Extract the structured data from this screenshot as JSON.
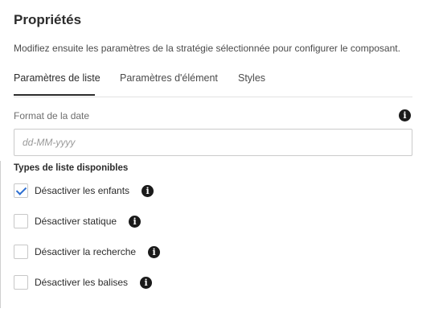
{
  "panel": {
    "title": "Propriétés",
    "description": "Modifiez ensuite les paramètres de la stratégie sélectionnée pour configurer le composant."
  },
  "tabs": [
    {
      "label": "Paramètres de liste",
      "active": true
    },
    {
      "label": "Paramètres d'élément",
      "active": false
    },
    {
      "label": "Styles",
      "active": false
    }
  ],
  "date_format": {
    "label": "Format de la date",
    "placeholder": "dd-MM-yyyy",
    "value": "",
    "info_icon": "info-icon"
  },
  "list_types": {
    "heading": "Types de liste disponibles",
    "items": [
      {
        "label": "Désactiver les enfants",
        "checked": true
      },
      {
        "label": "Désactiver statique",
        "checked": false
      },
      {
        "label": "Désactiver la recherche",
        "checked": false
      },
      {
        "label": "Désactiver les balises",
        "checked": false
      }
    ]
  },
  "colors": {
    "checkmark": "#2d6fd1",
    "text": "#2c2c2c",
    "border": "#cacaca"
  }
}
